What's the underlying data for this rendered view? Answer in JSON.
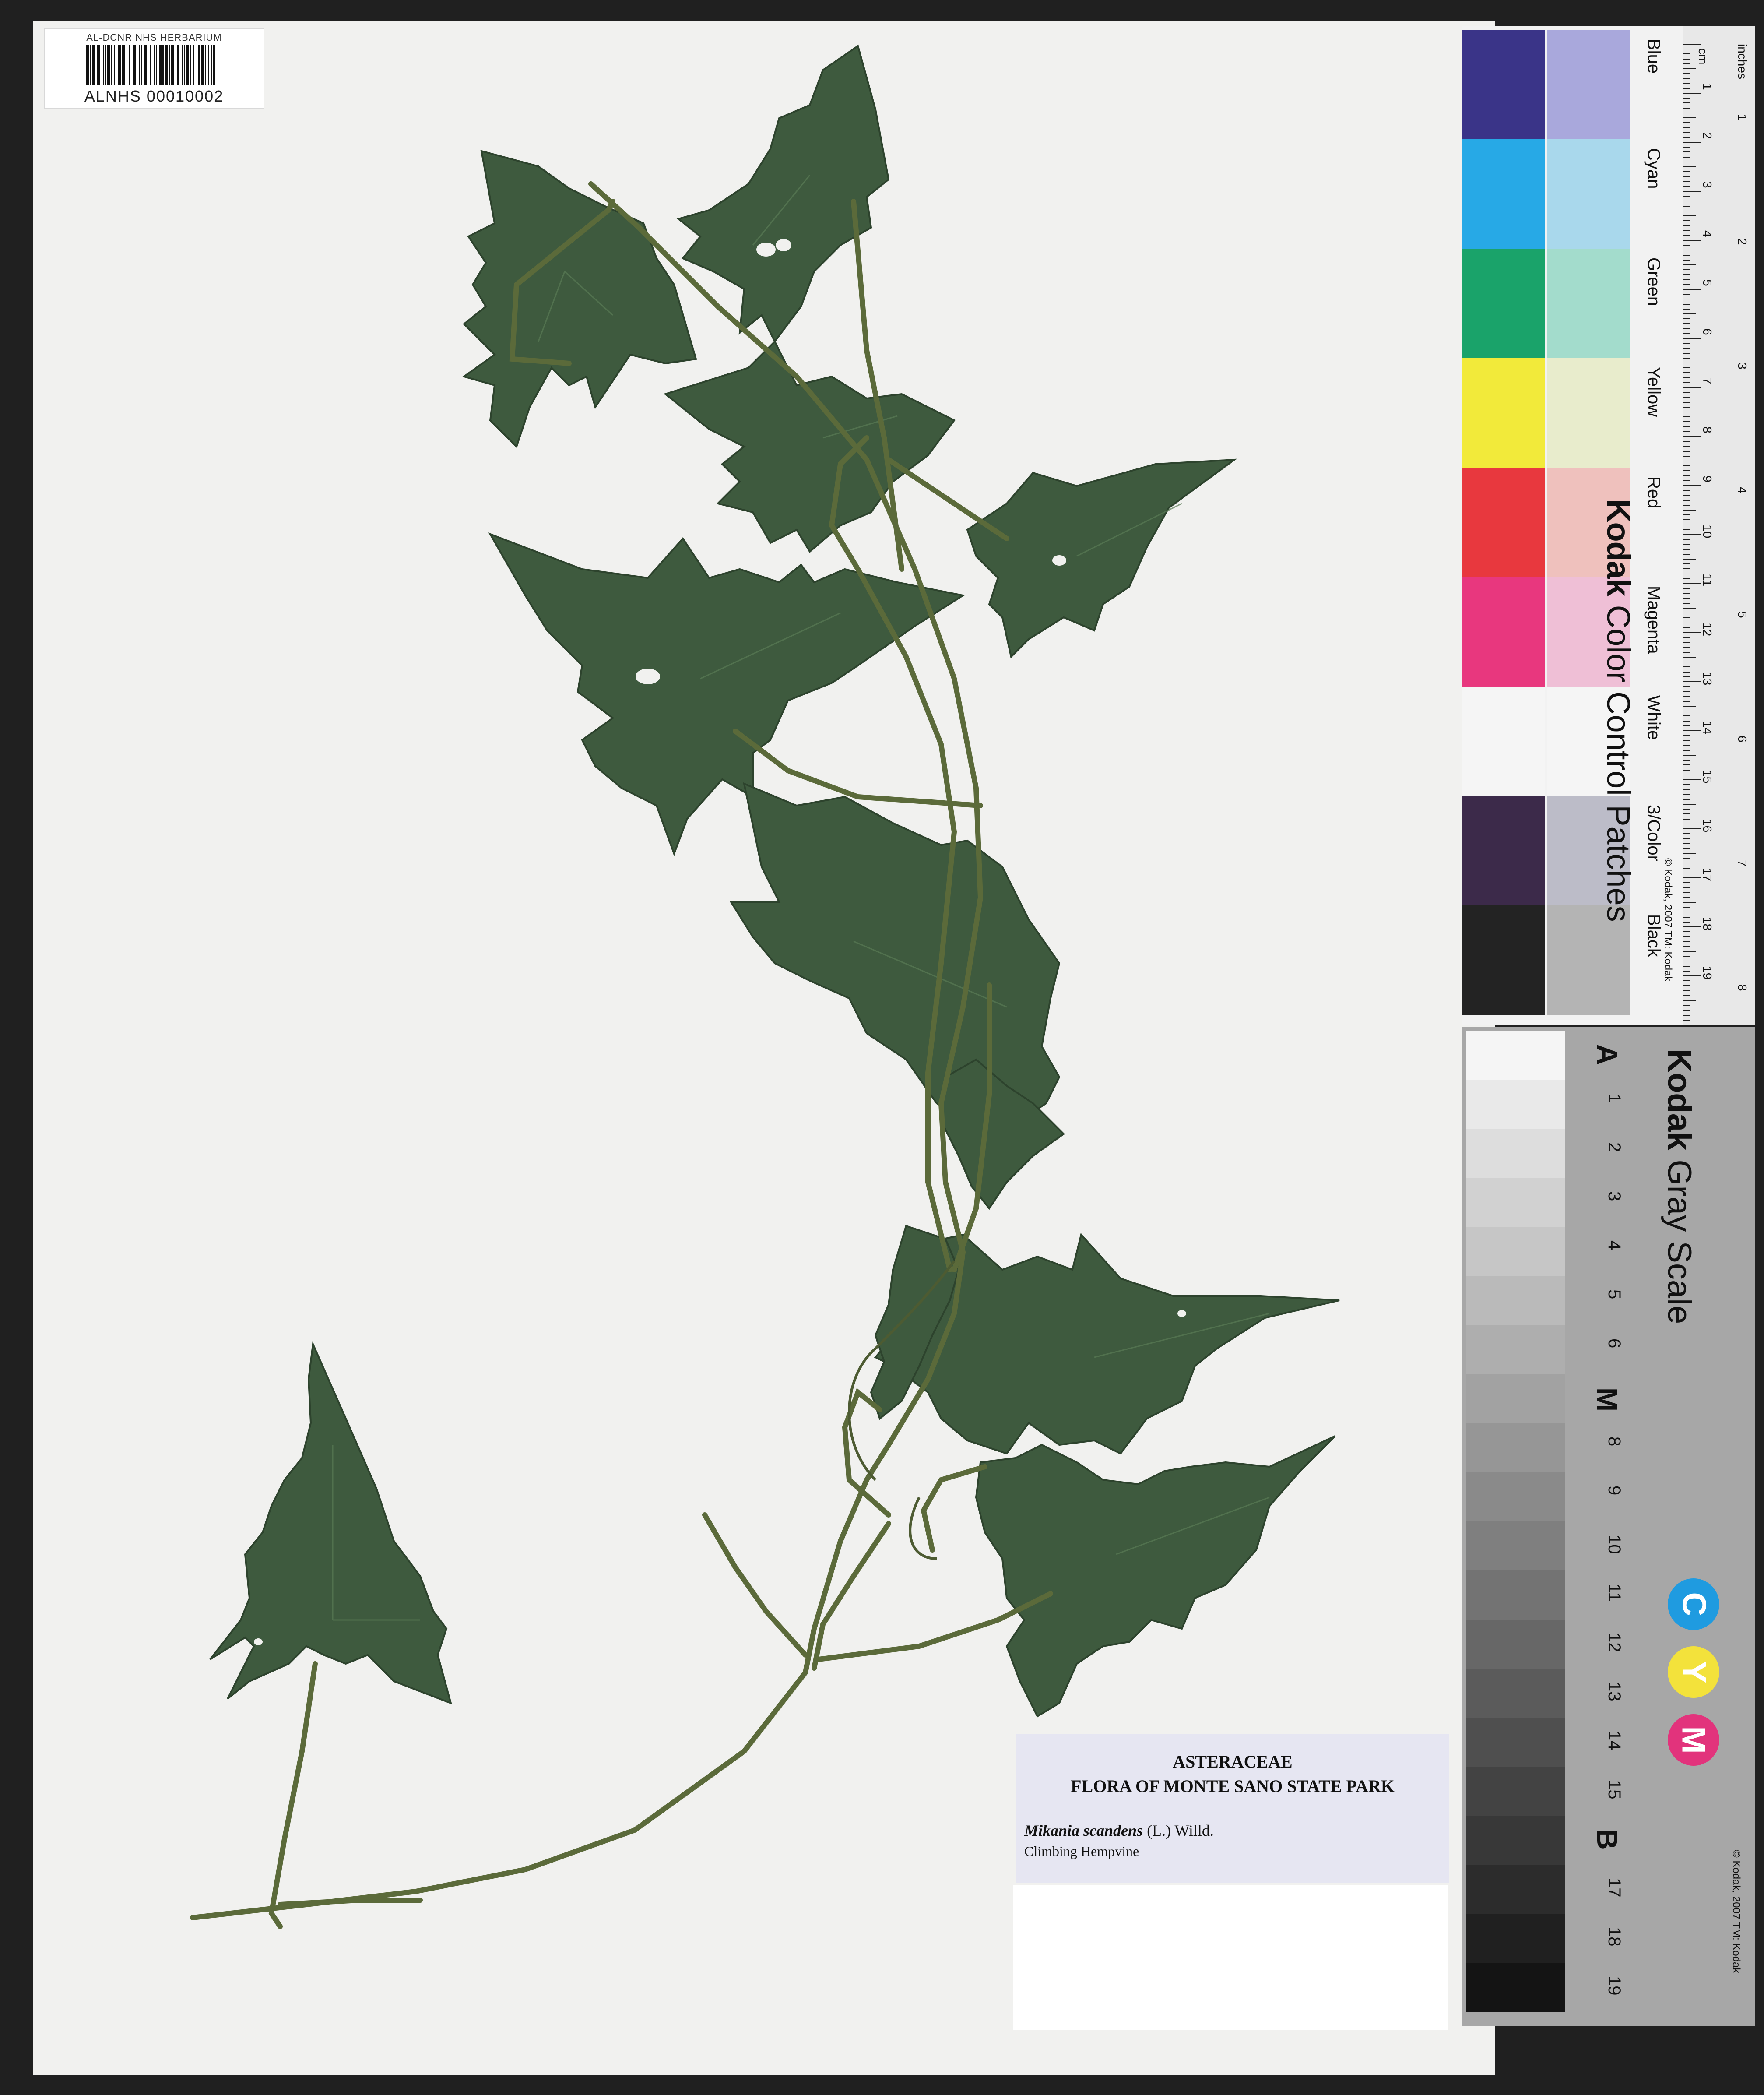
{
  "barcode_label": {
    "institution": "AL-DCNR NHS HERBARIUM",
    "catalog_number": "ALNHS 00010002"
  },
  "determination_label": {
    "family": "ASTERACEAE",
    "collection": "FLORA OF MONTE SANO STATE PARK",
    "scientific_name": "Mikania scandens",
    "authority": "(L.) Willd.",
    "common_name": "Climbing Hempvine"
  },
  "color_card": {
    "brand": "Kodak",
    "title": "Color Control Patches",
    "copyright": "© Kodak, 2007  TM: Kodak",
    "ruler_units": [
      "cm",
      "inches"
    ],
    "ruler_cm": [
      "1",
      "2",
      "3",
      "4",
      "5",
      "6",
      "7",
      "8",
      "9",
      "10",
      "11",
      "12",
      "13",
      "14",
      "15",
      "16",
      "17",
      "18",
      "19"
    ],
    "ruler_in": [
      "1",
      "2",
      "3",
      "4",
      "5",
      "6",
      "7",
      "8"
    ],
    "patches": [
      {
        "name": "Blue",
        "dark": "#3a3488",
        "light": "#a9a8dc"
      },
      {
        "name": "Cyan",
        "dark": "#27a9e6",
        "light": "#a9d8ec"
      },
      {
        "name": "Green",
        "dark": "#1aa36a",
        "light": "#a3dccc"
      },
      {
        "name": "Yellow",
        "dark": "#f2ea3a",
        "light": "#e8eccc"
      },
      {
        "name": "Red",
        "dark": "#e8383e",
        "light": "#efc1bd"
      },
      {
        "name": "Magenta",
        "dark": "#e8377e",
        "light": "#efbfd6"
      },
      {
        "name": "White",
        "dark": "#f5f5f5",
        "light": "#f5f5f5"
      },
      {
        "name": "3/Color",
        "dark": "#3c2a4a",
        "light": "#bcbcc8"
      },
      {
        "name": "Black",
        "dark": "#232323",
        "light": "#b4b4b4"
      }
    ]
  },
  "gray_card": {
    "brand": "Kodak",
    "title": "Gray Scale",
    "copyright": "© Kodak, 2007  TM: Kodak",
    "steps": [
      "A",
      "1",
      "2",
      "3",
      "4",
      "5",
      "6",
      "M",
      "8",
      "9",
      "10",
      "11",
      "12",
      "13",
      "14",
      "15",
      "B",
      "17",
      "18",
      "19"
    ],
    "cym": [
      {
        "letter": "C",
        "color": "#1f9be0"
      },
      {
        "letter": "Y",
        "color": "#f3e23b"
      },
      {
        "letter": "M",
        "color": "#e2337c"
      }
    ]
  },
  "colors": {
    "leaf": "#3e5a3e",
    "leaf_dark": "#2f472f",
    "stem": "#5a6a3c",
    "sheet": "#f1f1ef",
    "background": "#202020"
  }
}
